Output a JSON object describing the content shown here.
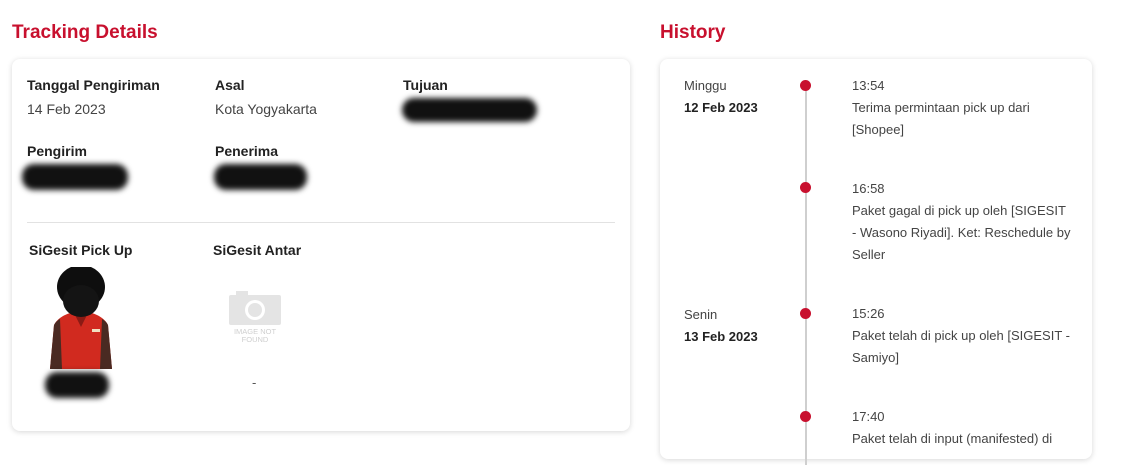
{
  "tracking": {
    "title": "Tracking Details",
    "fields": {
      "tanggal_label": "Tanggal Pengiriman",
      "tanggal_value": "14 Feb 2023",
      "asal_label": "Asal",
      "asal_value": "Kota Yogyakarta",
      "tujuan_label": "Tujuan",
      "tujuan_value": "",
      "pengirim_label": "Pengirim",
      "pengirim_value": "",
      "penerima_label": "Penerima",
      "penerima_value": ""
    },
    "couriers": {
      "pickup_label": "SiGesit Pick Up",
      "pickup_name": "",
      "antar_label": "SiGesit Antar",
      "antar_name": "-",
      "placeholder_text_1": "IMAGE NOT",
      "placeholder_text_2": "FOUND"
    }
  },
  "history": {
    "title": "History",
    "events": [
      {
        "day": "Minggu",
        "date": "12 Feb 2023",
        "time": "13:54",
        "desc": "Terima permintaan pick up dari [Shopee]"
      },
      {
        "day": "",
        "date": "",
        "time": "16:58",
        "desc": "Paket gagal di pick up oleh [SIGESIT - Wasono Riyadi]. Ket: Reschedule by Seller"
      },
      {
        "day": "Senin",
        "date": "13 Feb 2023",
        "time": "15:26",
        "desc": "Paket telah di pick up oleh [SIGESIT - Samiyo]"
      },
      {
        "day": "",
        "date": "",
        "time": "17:40",
        "desc": "Paket telah di input (manifested) di"
      }
    ]
  },
  "colors": {
    "accent": "#c8102e",
    "timeline_line": "#cfcfcf"
  }
}
